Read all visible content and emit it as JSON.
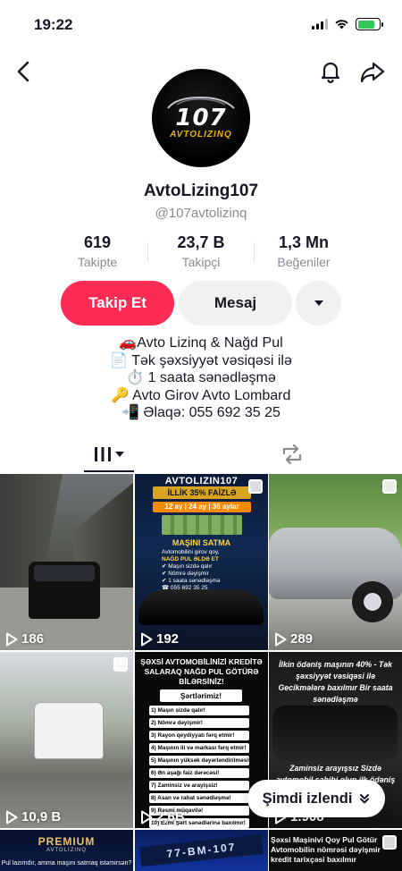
{
  "status_bar": {
    "time": "19:22",
    "battery_percent": 80
  },
  "colors": {
    "accent": "#fe2c55",
    "secondary_bg": "#f1f1f2",
    "muted_text": "#8a8b91",
    "battery": "#34c759"
  },
  "icons": {
    "back": "chevron-left-icon",
    "bell": "bell-icon",
    "share": "share-arrow-icon",
    "more": "caret-down-icon",
    "grid_tab": "grid-icon",
    "repost_tab": "repost-icon",
    "play": "play-icon",
    "multi": "carousel-icon"
  },
  "profile": {
    "avatar": {
      "number": "107",
      "brand": "AVTOLIZINQ"
    },
    "username": "AvtoLizing107",
    "handle": "@107avtolizinq",
    "stats": [
      {
        "value": "619",
        "label": "Takipte"
      },
      {
        "value": "23,7 B",
        "label": "Takipçi"
      },
      {
        "value": "1,3 Mn",
        "label": "Beğeniler"
      }
    ],
    "buttons": {
      "follow": "Takip Et",
      "message": "Mesaj"
    },
    "bio": [
      "🚗Avto Lizinq & Nağd Pul",
      "📄 Tək şəxsiyyət vəsiqəsi ilə",
      "⏱️ 1 saata sənədləşmə",
      "🔑 Avto Girov Avto Lombard",
      "📲 Əlaqə: 055 692 35 25"
    ]
  },
  "videos": [
    {
      "views": "186"
    },
    {
      "views": "192",
      "banner": "AVTOLIZIN107",
      "rate": "İLLİK 35% FAİZLƏ",
      "terms": "12 ay | 24 ay | 36 aylar",
      "headline": "MAŞINI SATMA",
      "lines": [
        "Avtomobilini girov qoy,",
        "NAĞD PUL ƏLDƏ ET",
        "✔ Maşın sizdə qalır",
        "✔ Nömrə dəyişmir",
        "✔ 1 saata sənədləşmə",
        "☎ 055 692 35 25"
      ]
    },
    {
      "views": "289"
    },
    {
      "views": "10,9 B"
    },
    {
      "views": "2,6B",
      "title": "ŞƏXSİ AVTOMOBİLİNİZİ KREDİTƏ SALARAQ NAĞD PUL GÖTÜRƏ BİLƏRSİNİZ!",
      "conditions": "Şərtlərimiz!",
      "items": [
        "1) Maşın sizdə qalır!",
        "2) Nömrə dəyişmir!",
        "3) Rayon qeydiyyatı fərq etmir!",
        "4) Maşının ili və markası fərq etmir!",
        "5) Maşının yüksək dəyərləndirilməsi!",
        "6) Ən aşağı faiz dərəcəsi!",
        "7) Zaminsiz və arayişsiz!",
        "8) Asan və rahat sənədləşmə!",
        "9) Rəsmi müqavilə!",
        "10) Ezmi Şərt sənədlərinə baxılmır!"
      ]
    },
    {
      "views": "1.908",
      "top_text": "İlkin ödəniş maşının 40% - Tək şəxsiyyət vəsiqəsi ilə Gecikmələrə baxılmır Bir saata sənədləşmə",
      "bottom_text": "Zaminsiz arayışsız Sizdə avtomobil sahibi olun ilk ödəniş ilə"
    }
  ],
  "bottom_row": [
    {
      "title": "PREMIUM",
      "subtitle": "AVTOLIZINQ",
      "question": "Pul lazımdır, amma maşını satmaq istəmirsən?"
    },
    {
      "plate": "77-BM-107"
    },
    {
      "text": "Şəxsi Maşinivi Qoy Pul Götür Avtomobilin nömrəsi dəyişmir kredit tarixçəsi baxılmır"
    }
  ],
  "toast": {
    "label": "Şimdi izlendi"
  }
}
